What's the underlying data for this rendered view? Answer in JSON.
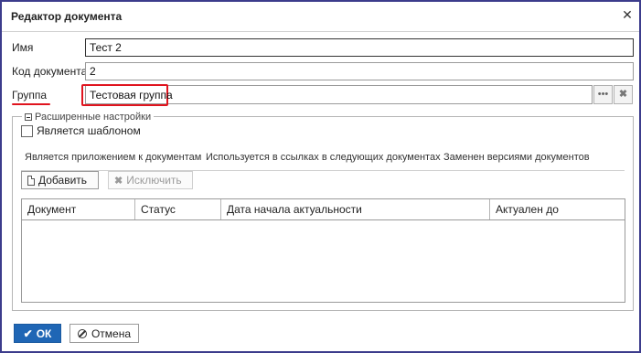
{
  "window": {
    "title": "Редактор документа",
    "close_icon": "close-icon"
  },
  "fields": {
    "name": {
      "label": "Имя",
      "value": "Тест 2"
    },
    "code": {
      "label": "Код документа",
      "value": "2"
    },
    "group": {
      "label": "Группа",
      "value": "Тестовая группа",
      "browse_icon": "ellipsis-icon",
      "clear_icon": "clear-icon"
    }
  },
  "advanced": {
    "legend": "Расширенные настройки",
    "is_template_label": "Является шаблоном",
    "is_template_checked": false
  },
  "tabs": [
    {
      "label": "Является приложением к документам",
      "active": true
    },
    {
      "label": "Используется в ссылках в следующих документах",
      "active": false
    },
    {
      "label": "Заменен версиями документов",
      "active": false
    }
  ],
  "toolbar": {
    "add_label": "Добавить",
    "exclude_label": "Исключить"
  },
  "table": {
    "columns": [
      "Документ",
      "Статус",
      "Дата начала актуальности",
      "Актуален до"
    ],
    "rows": []
  },
  "footer": {
    "ok_label": "ОК",
    "cancel_label": "Отмена"
  },
  "colors": {
    "accent": "#1f66b5",
    "highlight": "#e0141e",
    "frame": "#3c3c8c"
  }
}
